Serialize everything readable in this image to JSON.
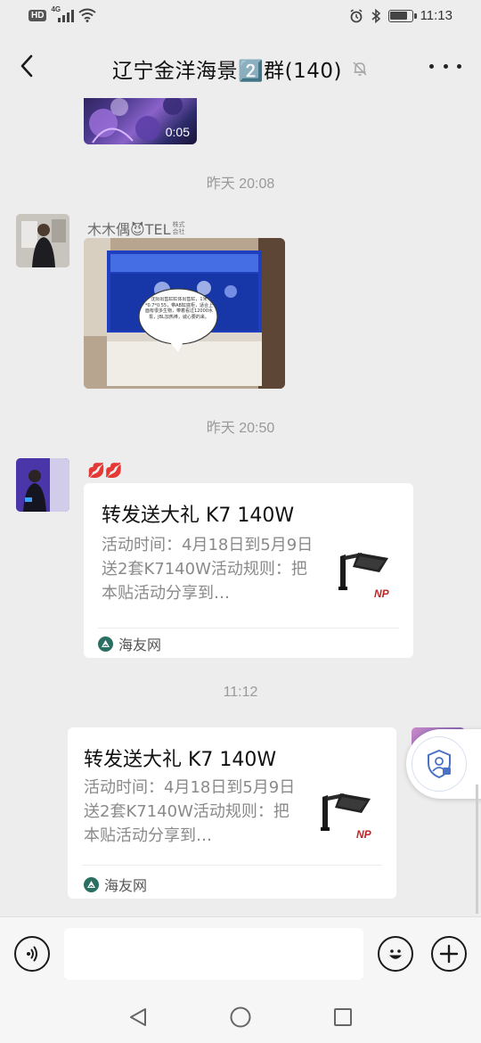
{
  "status_bar": {
    "hd": "HD",
    "network": "4G",
    "time": "11:13",
    "battery_level": 0.85
  },
  "header": {
    "title": "辽宁金洋海景2️⃣群(140)"
  },
  "messages": {
    "video_duration": "0:05",
    "time_1": "昨天 20:08",
    "sender_1": "木木偶😈TEL",
    "sender_1_badge_top": "株式",
    "sender_1_badge_bottom": "会社",
    "time_2": "昨天 20:50",
    "sender_2": "💋💋",
    "time_3": "11:12"
  },
  "photo_caption": "沈阳出售缸缸体出售缸，1米*0.7*0.55，带AB缸底柜，适合上面有很多生物，带着看过12000水泵，JBL加热棒，诚心要的来。",
  "cards": [
    {
      "title": "转发送大礼 K7 140W",
      "desc": "活动时间：4月18日到5月9日送2套K7140W活动规则：把本贴活动分享到…",
      "source": "海友网",
      "thumb_label": "NP"
    },
    {
      "title": "转发送大礼 K7 140W",
      "desc": "活动时间：4月18日到5月9日送2套K7140W活动规则：把本贴活动分享到…",
      "source": "海友网",
      "thumb_label": "NP"
    }
  ],
  "input": {
    "placeholder": ""
  },
  "icons": {
    "back": "back-arrow-icon",
    "mute": "bell-muted-icon",
    "more": "more-icon",
    "voice": "voice-icon",
    "emoji": "emoji-icon",
    "plus": "plus-icon",
    "shield": "shield-user-icon"
  },
  "colors": {
    "background": "#ededed",
    "bubble": "#ffffff",
    "source_icon": "#2b6f62",
    "shield_accent": "#4a72c4"
  }
}
